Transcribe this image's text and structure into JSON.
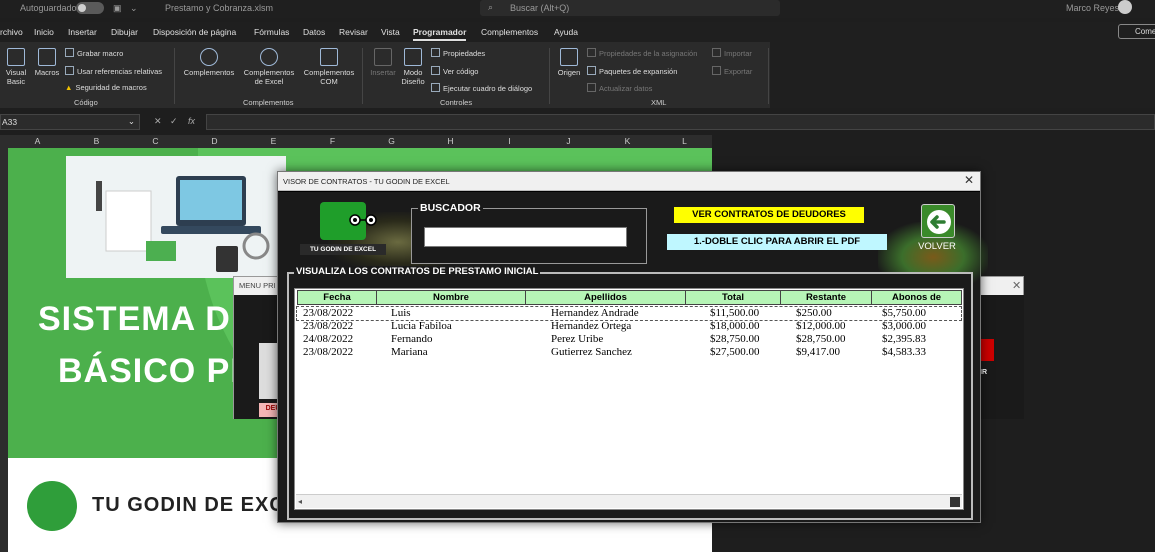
{
  "titlebar": {
    "autosave_label": "Autoguardado",
    "filename": "Prestamo y Cobranza.xlsm",
    "search_placeholder": "Buscar (Alt+Q)",
    "user_name": "Marco Reyes"
  },
  "menu": {
    "items": [
      "rchivo",
      "Inicio",
      "Insertar",
      "Dibujar",
      "Disposición de página",
      "Fórmulas",
      "Datos",
      "Revisar",
      "Vista",
      "Programador",
      "Complementos",
      "Ayuda"
    ],
    "active": "Programador",
    "comentarios": "Come"
  },
  "ribbon": {
    "codigo": {
      "visual_basic": "Visual Basic",
      "macros": "Macros",
      "grabar_macro": "Grabar macro",
      "usar_referencias": "Usar referencias relativas",
      "seguridad_macros": "Seguridad de macros",
      "label": "Código"
    },
    "complementos": {
      "complementos": "Complementos",
      "complementos_excel": "Complementos de Excel",
      "complementos_com": "Complementos COM",
      "label": "Complementos"
    },
    "controles": {
      "insertar": "Insertar",
      "modo_diseno": "Modo Diseño",
      "propiedades": "Propiedades",
      "ver_codigo": "Ver código",
      "ejecutar_cuadro": "Ejecutar cuadro de diálogo",
      "label": "Controles"
    },
    "xml": {
      "origen": "Origen",
      "propiedades_asignacion": "Propiedades de la asignación",
      "paquetes_expansion": "Paquetes de expansión",
      "actualizar_datos": "Actualizar datos",
      "importar": "Importar",
      "exportar": "Exportar",
      "label": "XML"
    }
  },
  "formula_bar": {
    "name_box": "A33",
    "fx": "fx",
    "value": ""
  },
  "sheet": {
    "columns": [
      "A",
      "B",
      "C",
      "D",
      "E",
      "F",
      "G",
      "H",
      "I",
      "J",
      "K",
      "L"
    ],
    "title_line1": "SISTEMA DI",
    "title_line2": "BÁSICO PE",
    "brand": "TU GODIN DE EXC"
  },
  "menu_form": {
    "title": "MENU PRI",
    "left_button": "DEU",
    "right_label": "IR"
  },
  "dialog": {
    "title": "VISOR DE CONTRATOS - TU GODIN DE EXCEL",
    "logo_text": "TU GODIN DE EXCEL",
    "buscador_label": "BUSCADOR",
    "buscador_value": "",
    "btn_deudores": "VER CONTRATOS DE DEUDORES",
    "btn_pdf": "1.-DOBLE CLIC PARA ABRIR EL PDF",
    "btn_volver": "VOLVER",
    "list_label": "VISUALIZA LOS CONTRATOS DE PRESTAMO INICIAL",
    "columns": [
      "Fecha",
      "Nombre",
      "Apellidos",
      "Total",
      "Restante",
      "Abonos de"
    ],
    "rows": [
      {
        "fecha": "23/08/2022",
        "nombre": "Luis",
        "apellidos": "Hernandez Andrade",
        "total": "$11,500.00",
        "restante": "$250.00",
        "abonos": "$5,750.00"
      },
      {
        "fecha": "23/08/2022",
        "nombre": "Lucia Fabiloa",
        "apellidos": "Hernandez Ortega",
        "total": "$18,000.00",
        "restante": "$12,000.00",
        "abonos": "$3,000.00"
      },
      {
        "fecha": "24/08/2022",
        "nombre": "Fernando",
        "apellidos": "Perez Uribe",
        "total": "$28,750.00",
        "restante": "$28,750.00",
        "abonos": "$2,395.83"
      },
      {
        "fecha": "23/08/2022",
        "nombre": "Mariana",
        "apellidos": "Gutierrez Sanchez",
        "total": "$27,500.00",
        "restante": "$9,417.00",
        "abonos": "$4,583.33"
      }
    ]
  }
}
